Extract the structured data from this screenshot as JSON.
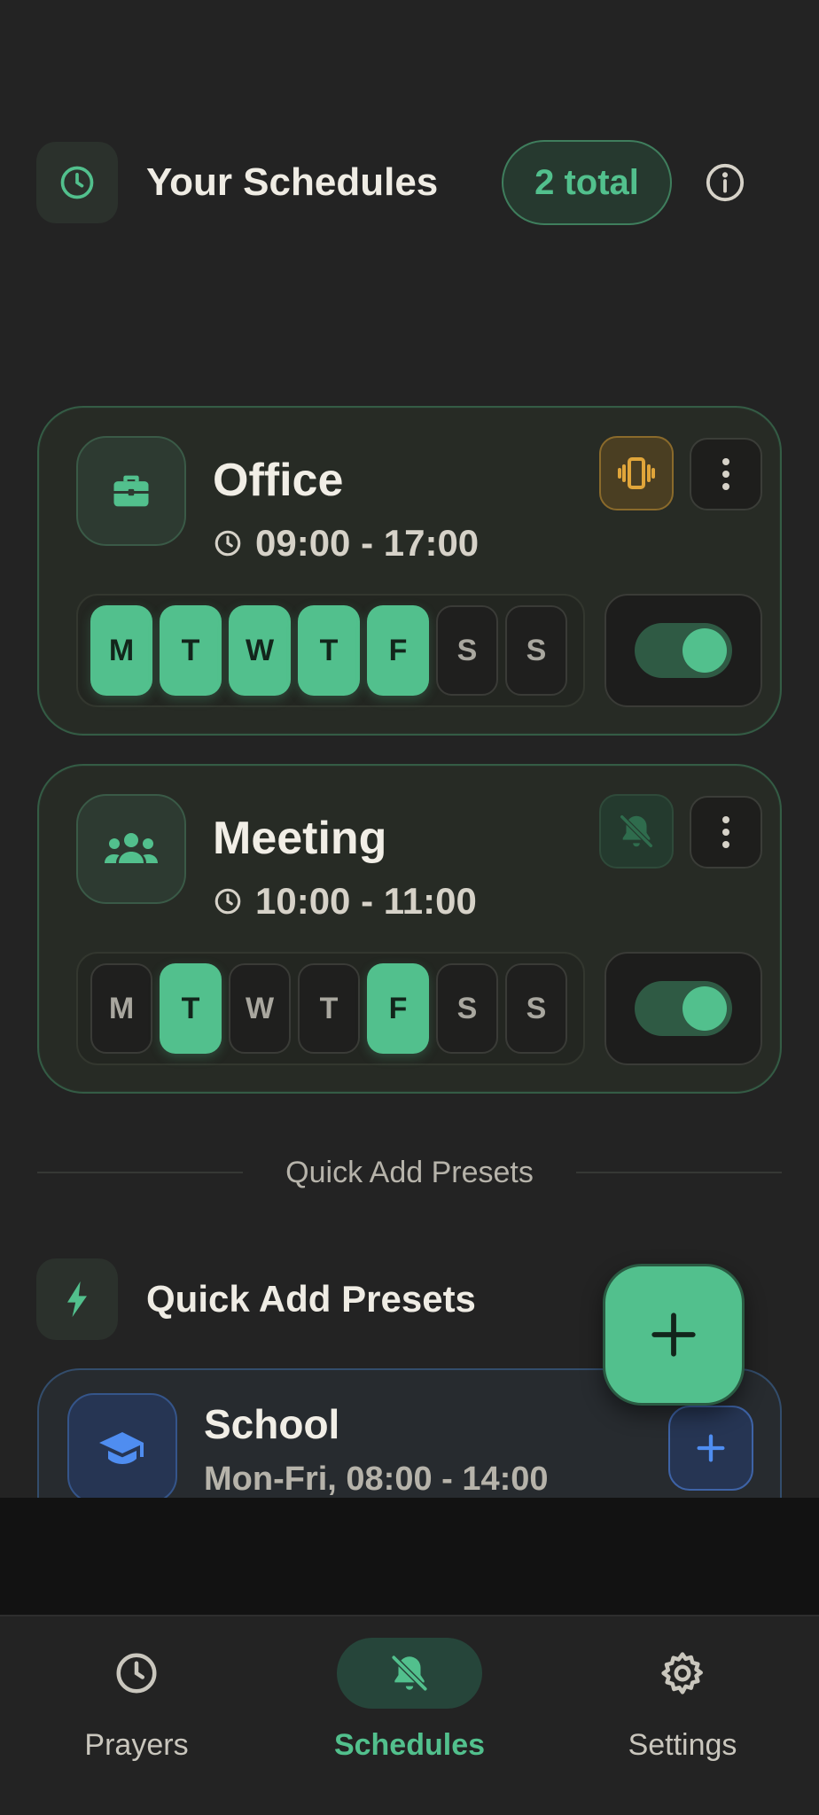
{
  "header": {
    "title": "Your Schedules",
    "total_badge": "2 total",
    "icon": "clock-icon"
  },
  "schedules": [
    {
      "name": "Office",
      "icon": "briefcase-icon",
      "time": "09:00 - 17:00",
      "mode": "vibrate",
      "enabled": true,
      "days": [
        {
          "label": "M",
          "on": true
        },
        {
          "label": "T",
          "on": true
        },
        {
          "label": "W",
          "on": true
        },
        {
          "label": "T",
          "on": true
        },
        {
          "label": "F",
          "on": true
        },
        {
          "label": "S",
          "on": false
        },
        {
          "label": "S",
          "on": false
        }
      ]
    },
    {
      "name": "Meeting",
      "icon": "group-icon",
      "time": "10:00 - 11:00",
      "mode": "silent",
      "enabled": true,
      "days": [
        {
          "label": "M",
          "on": false
        },
        {
          "label": "T",
          "on": true
        },
        {
          "label": "W",
          "on": false
        },
        {
          "label": "T",
          "on": false
        },
        {
          "label": "F",
          "on": true
        },
        {
          "label": "S",
          "on": false
        },
        {
          "label": "S",
          "on": false
        }
      ]
    }
  ],
  "divider_label": "Quick Add Presets",
  "presets_section": {
    "title": "Quick Add Presets",
    "icon": "lightning-icon",
    "items": [
      {
        "name": "School",
        "subtitle": "Mon-Fri, 08:00 - 14:00",
        "icon": "graduation-cap-icon"
      }
    ]
  },
  "nav": {
    "items": [
      {
        "label": "Prayers",
        "icon": "clock-icon",
        "active": false
      },
      {
        "label": "Schedules",
        "icon": "bell-off-icon",
        "active": true
      },
      {
        "label": "Settings",
        "icon": "gear-icon",
        "active": false
      }
    ]
  },
  "colors": {
    "accent": "#52c08d",
    "background": "#232323",
    "vibrate": "#e0a53a",
    "preset_blue": "#4f8df0"
  }
}
